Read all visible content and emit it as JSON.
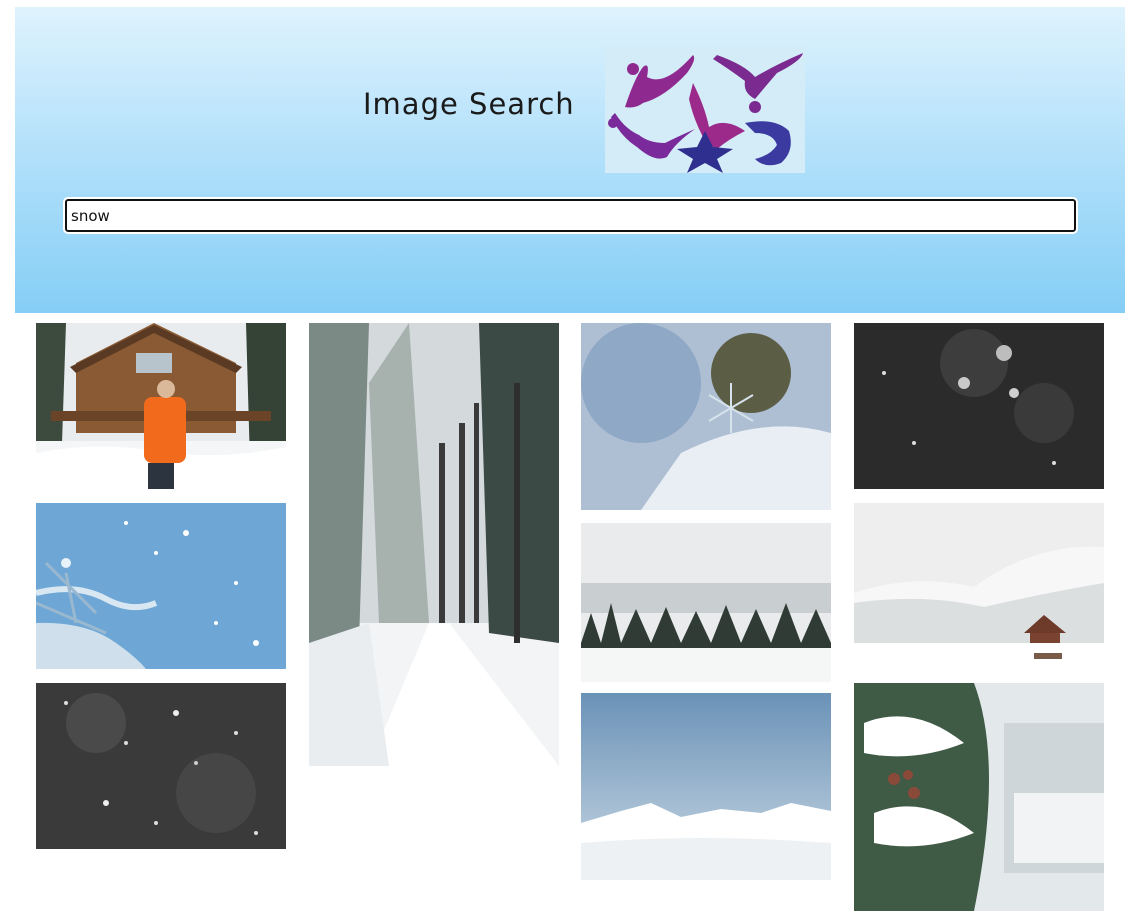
{
  "header": {
    "title": "Image Search",
    "logo_name": "dancers-logo",
    "search_value": "snow",
    "gradient_top": "#dff3fd",
    "gradient_bottom": "#85cef5"
  },
  "gallery": {
    "images": [
      {
        "id": "cabin-woman-orange-jacket",
        "dominant": "#d9d9d9"
      },
      {
        "id": "blue-sky-snowfall-branch",
        "dominant": "#6fa8d6"
      },
      {
        "id": "dark-bokeh-snowfall",
        "dominant": "#3a3a3a"
      },
      {
        "id": "snowy-forest-road",
        "dominant": "#e6e8ea"
      },
      {
        "id": "snowflake-macro",
        "dominant": "#b8c9dc"
      },
      {
        "id": "misty-pine-forest-lake",
        "dominant": "#e8eaea"
      },
      {
        "id": "snowy-mountains-blue-sky",
        "dominant": "#8fb3cf"
      },
      {
        "id": "dark-forest-snowfall",
        "dominant": "#2b2b2b"
      },
      {
        "id": "snowy-hills-cabin",
        "dominant": "#eeeeee"
      },
      {
        "id": "snowy-pine-branch-cabin",
        "dominant": "#dfe6ea"
      }
    ]
  }
}
